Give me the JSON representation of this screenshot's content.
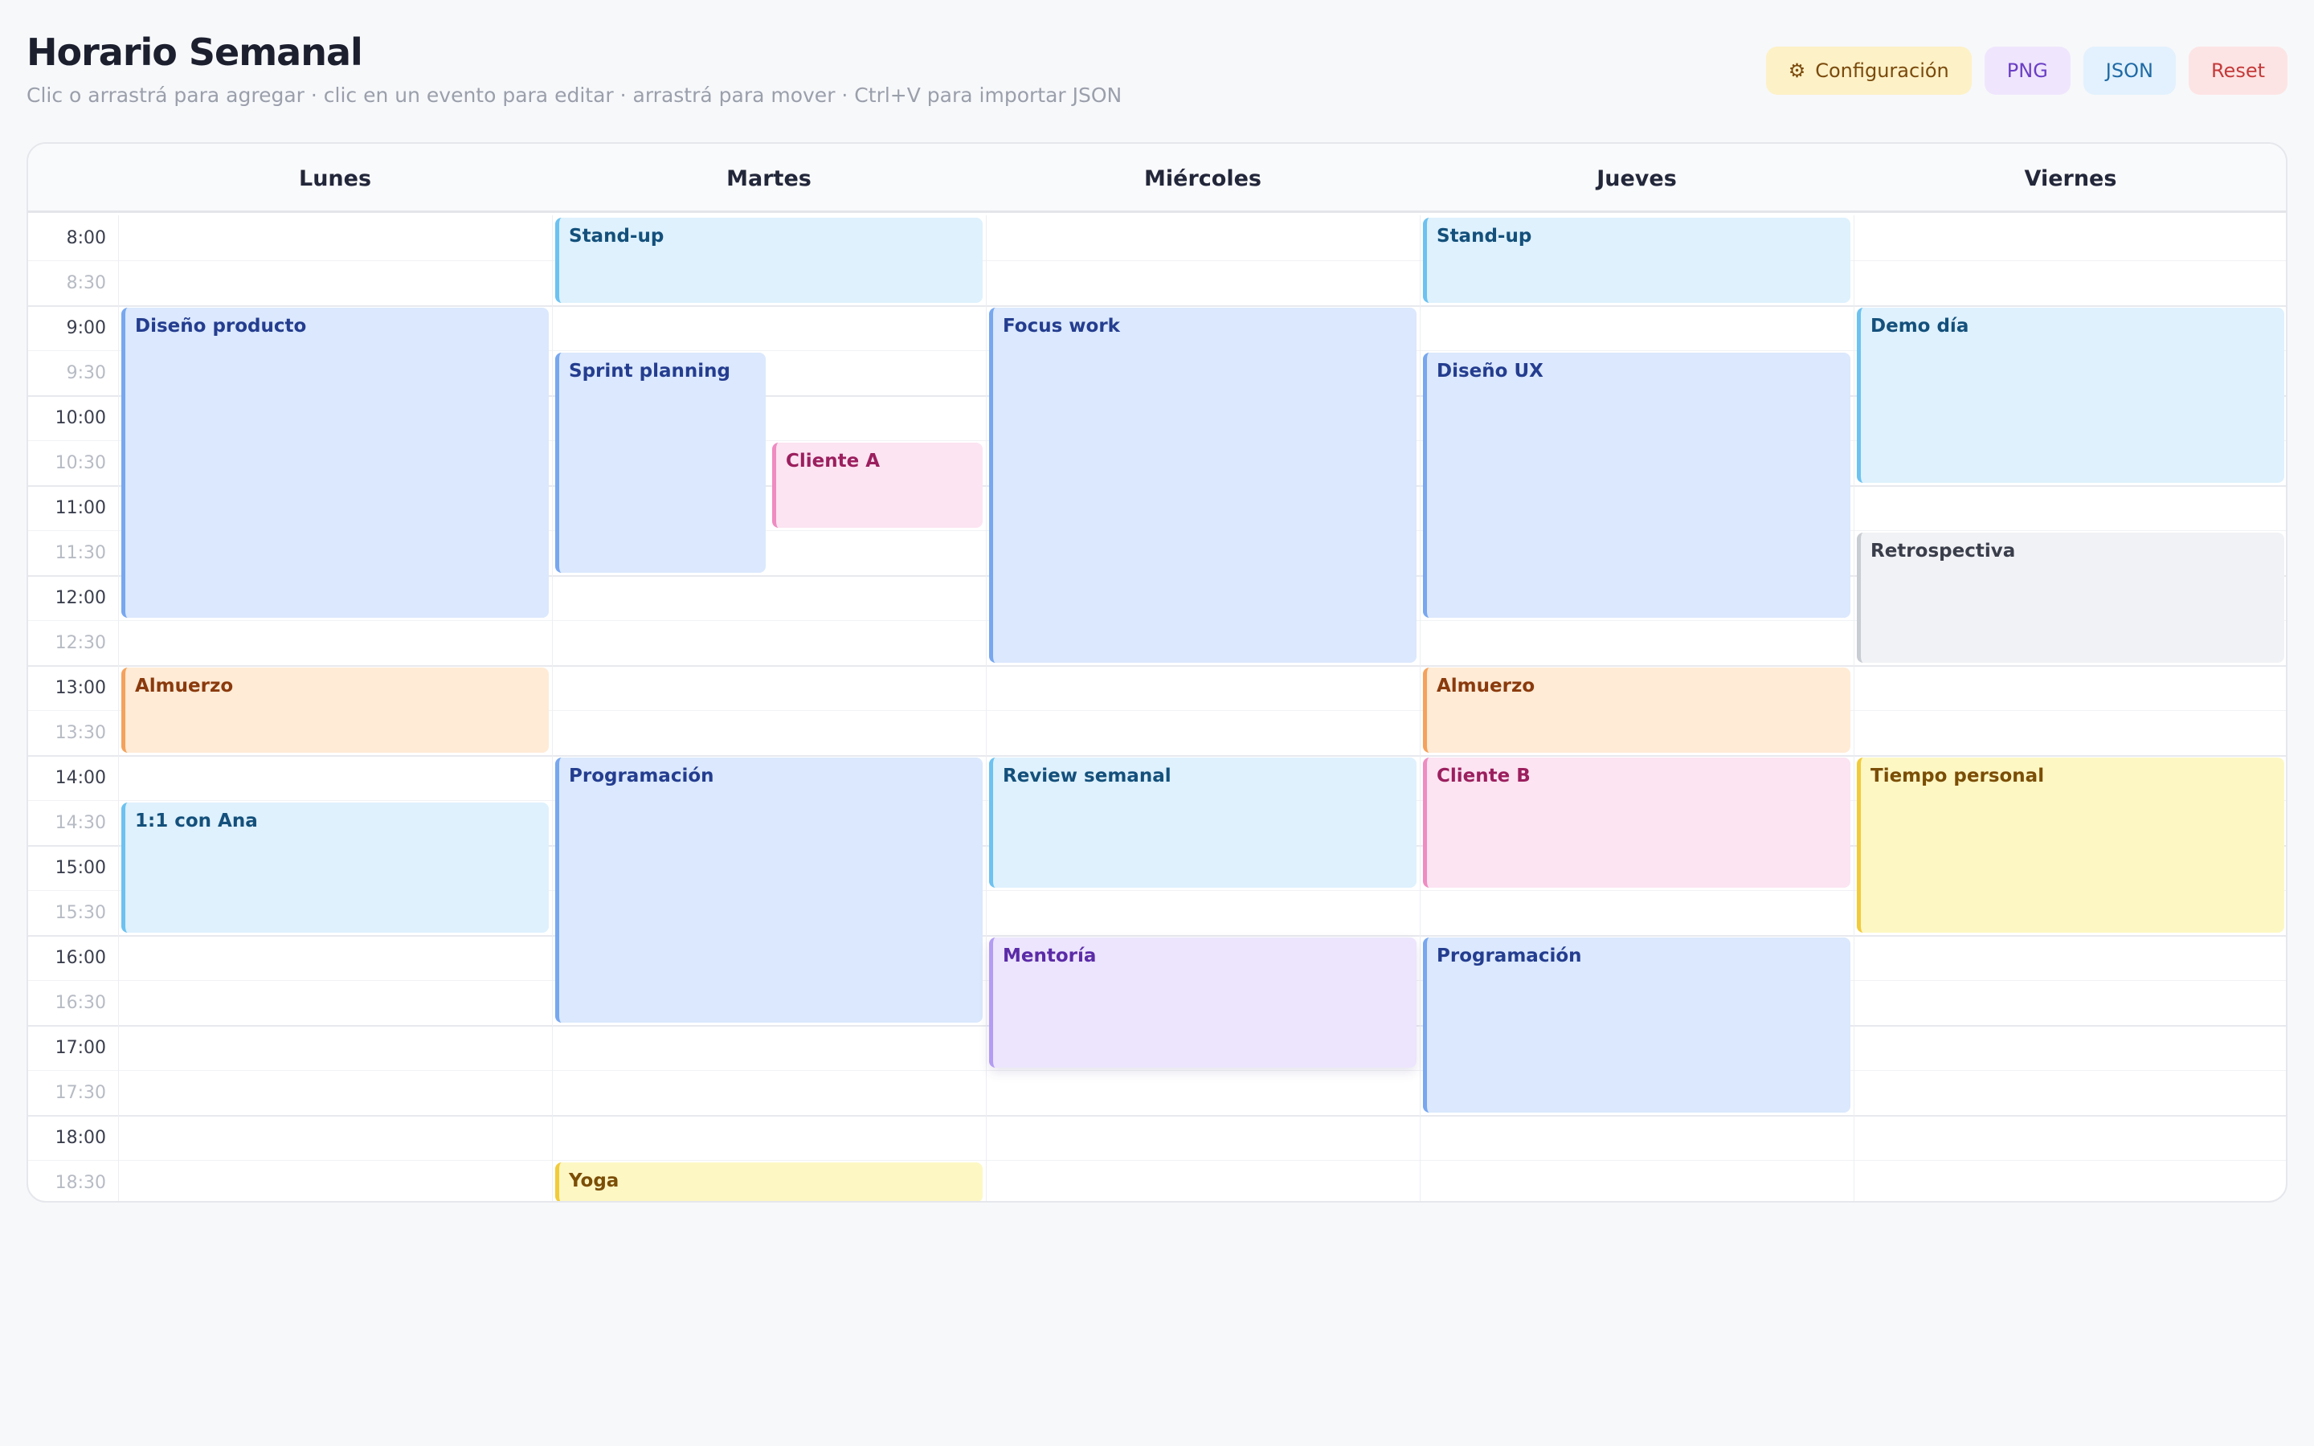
{
  "header": {
    "title": "Horario Semanal",
    "subtitle": "Clic o arrastrá para agregar · clic en un evento para editar · arrastrá para mover · Ctrl+V para importar JSON"
  },
  "actions": {
    "config_icon": "⚙",
    "config_label": "Configuración",
    "png_label": "PNG",
    "json_label": "JSON",
    "reset_label": "Reset"
  },
  "days": [
    "Lunes",
    "Martes",
    "Miércoles",
    "Jueves",
    "Viernes"
  ],
  "times": [
    "8:00",
    "8:30",
    "9:00",
    "9:30",
    "10:00",
    "10:30",
    "11:00",
    "11:30",
    "12:00",
    "12:30",
    "13:00",
    "13:30",
    "14:00",
    "14:30",
    "15:00",
    "15:30",
    "16:00",
    "16:30",
    "17:00",
    "17:30",
    "18:00",
    "18:30"
  ],
  "colors": {
    "sky": "#def1fd",
    "blue": "#dbe8fd",
    "pink": "#fce4f2",
    "orange": "#ffebd6",
    "gray": "#f1f2f5",
    "yellow": "#fdf7c4",
    "purple": "#ece5fd"
  },
  "events": [
    {
      "title": "Diseño producto",
      "day": "Lunes",
      "start": "9:00",
      "end": "12:30",
      "color": "blue"
    },
    {
      "title": "Almuerzo",
      "day": "Lunes",
      "start": "13:00",
      "end": "14:00",
      "color": "orange"
    },
    {
      "title": "1:1 con Ana",
      "day": "Lunes",
      "start": "14:30",
      "end": "16:00",
      "color": "sky"
    },
    {
      "title": "Stand-up",
      "day": "Martes",
      "start": "8:00",
      "end": "9:00",
      "color": "sky"
    },
    {
      "title": "Sprint planning",
      "day": "Martes",
      "start": "9:30",
      "end": "12:00",
      "color": "blue"
    },
    {
      "title": "Cliente A",
      "day": "Martes",
      "start": "10:30",
      "end": "11:30",
      "color": "pink"
    },
    {
      "title": "Programación",
      "day": "Martes",
      "start": "14:00",
      "end": "17:00",
      "color": "blue"
    },
    {
      "title": "Yoga",
      "day": "Martes",
      "start": "18:30",
      "end": "19:00",
      "color": "yellow"
    },
    {
      "title": "Focus work",
      "day": "Miércoles",
      "start": "9:00",
      "end": "13:00",
      "color": "blue"
    },
    {
      "title": "Review semanal",
      "day": "Miércoles",
      "start": "14:00",
      "end": "15:30",
      "color": "sky"
    },
    {
      "title": "Mentoría",
      "day": "Miércoles",
      "start": "16:00",
      "end": "17:30",
      "color": "purple"
    },
    {
      "title": "Stand-up",
      "day": "Jueves",
      "start": "8:00",
      "end": "9:00",
      "color": "sky"
    },
    {
      "title": "Diseño UX",
      "day": "Jueves",
      "start": "9:30",
      "end": "12:30",
      "color": "blue"
    },
    {
      "title": "Almuerzo",
      "day": "Jueves",
      "start": "13:00",
      "end": "14:00",
      "color": "orange"
    },
    {
      "title": "Cliente B",
      "day": "Jueves",
      "start": "14:00",
      "end": "15:30",
      "color": "pink"
    },
    {
      "title": "Programación",
      "day": "Jueves",
      "start": "16:00",
      "end": "18:00",
      "color": "blue"
    },
    {
      "title": "Demo día",
      "day": "Viernes",
      "start": "9:00",
      "end": "11:00",
      "color": "sky"
    },
    {
      "title": "Retrospectiva",
      "day": "Viernes",
      "start": "11:30",
      "end": "13:00",
      "color": "gray"
    },
    {
      "title": "Tiempo personal",
      "day": "Viernes",
      "start": "14:00",
      "end": "16:00",
      "color": "yellow"
    }
  ]
}
